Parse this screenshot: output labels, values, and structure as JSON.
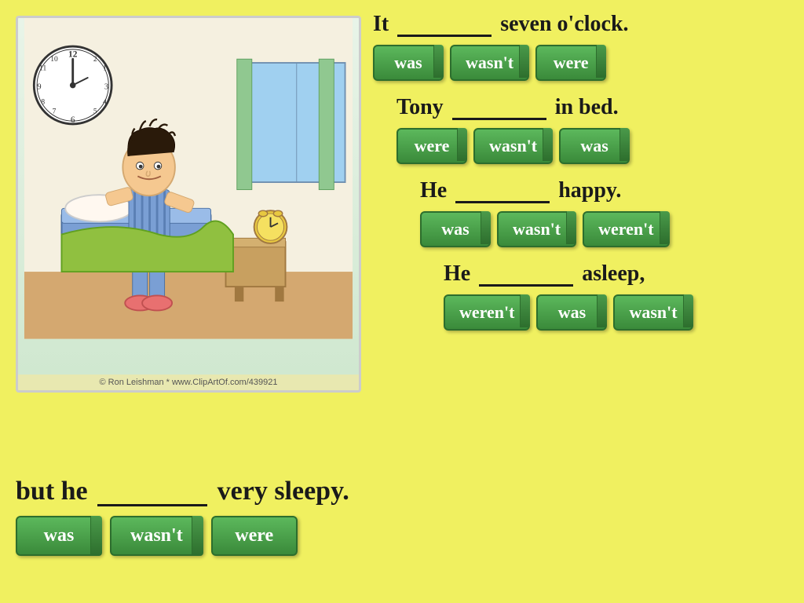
{
  "background_color": "#f0f060",
  "copyright": "© Ron Leishman * www.ClipArtOf.com/439921",
  "sentences": [
    {
      "id": "sentence-1",
      "text_before": "It",
      "text_after": "seven o'clock.",
      "options": [
        "was",
        "wasn't",
        "were"
      ]
    },
    {
      "id": "sentence-2",
      "text_before": "Tony",
      "text_after": "in bed.",
      "options": [
        "were",
        "wasn't",
        "was"
      ]
    },
    {
      "id": "sentence-3",
      "text_before": "He",
      "text_after": "happy.",
      "options": [
        "was",
        "wasn't",
        "weren't"
      ]
    },
    {
      "id": "sentence-4",
      "text_before": "He",
      "text_after": "asleep,",
      "options": [
        "weren't",
        "was",
        "wasn't"
      ]
    }
  ],
  "bottom_sentence": {
    "text_before": "but he",
    "text_after": "very sleepy.",
    "options": [
      "was",
      "wasn't",
      "were"
    ]
  }
}
